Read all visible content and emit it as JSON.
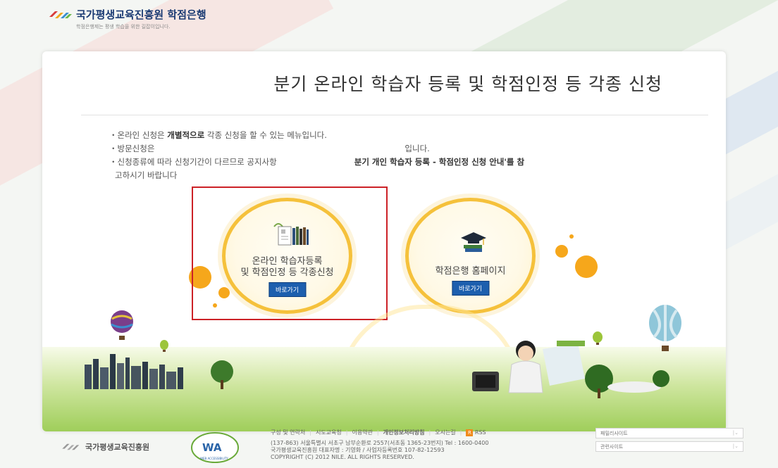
{
  "header": {
    "org_title": "국가평생교육진흥원 학점은행",
    "tagline": "학점은행제는 평생 학습을 위한 길잡이입니다."
  },
  "main": {
    "title": "분기 온라인 학습자 등록 및 학점인정 등 각종 신청",
    "notices": [
      {
        "prefix": "・온라인 신청은 ",
        "bold": "개별적으로",
        "suffix": " 각종 신청을 할 수 있는 메뉴입니다."
      },
      {
        "prefix": "・방문신청은",
        "suffix": "입니다."
      },
      {
        "prefix": "・신청종류에 따라 신청기간이 다르므로 공지사항",
        "bold": "분기 개인 학습자 등록 - 학점인정 신청 안내'를 참",
        "line2": "고하시기 바랍니다"
      }
    ],
    "cards": [
      {
        "label_line1": "온라인 학습자등록",
        "label_line2": "및 학점인정 등 각종신청",
        "button": "바로가기"
      },
      {
        "label_line1": "학점은행 홈페이지",
        "button": "바로가기"
      }
    ]
  },
  "footer": {
    "org_name": "국가평생교육진흥원",
    "wa_mark": "WA",
    "wa_caption": "WEB ACCESSIBILITY",
    "links": [
      "구성 및 연락처",
      "시도교육청",
      "이용약관",
      "개인정보처리방침",
      "오시는길",
      "RSS"
    ],
    "address_line1": "(137-863) 서울특별시 서초구 남부순환로 2557(서초동 1365-23번지)   Tel : 1600-0400",
    "address_line2": "국가평생교육진흥원   대표자명 : 기영화   / 사업자등록번호 107-82-12593",
    "copyright": "COPYRIGHT (C) 2012 NILE. ALL RIGHTS RESERVED.",
    "family_site": "패밀리사이트",
    "related_site": "관련사이트"
  },
  "colors": {
    "accent_blue": "#1d5fae",
    "circle_gold": "#f5c13b",
    "highlight_red": "#cc2127"
  }
}
